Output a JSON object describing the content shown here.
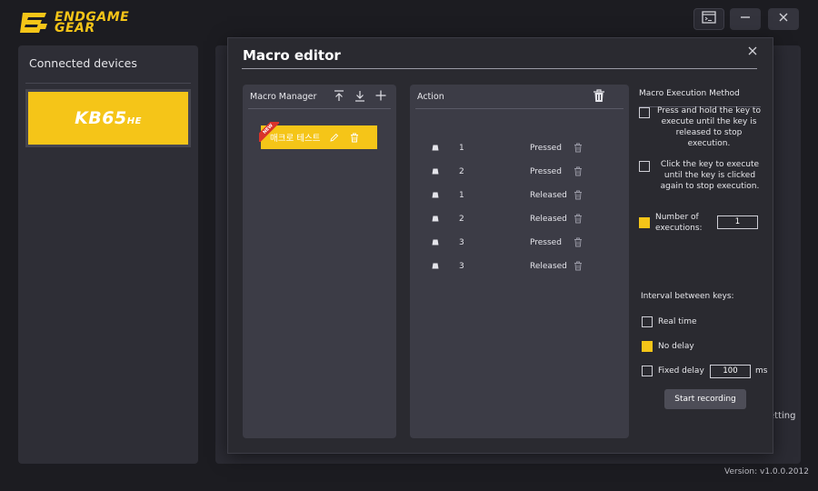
{
  "app": {
    "brand_line1": "ENDGAME",
    "brand_line2": "GEAR",
    "accent_color": "#f5c518",
    "window_buttons": [
      "terminal-icon",
      "minimize-icon",
      "close-icon"
    ]
  },
  "sidebar": {
    "title": "Connected devices",
    "device": {
      "name": "KB65",
      "suffix": "HE"
    }
  },
  "background": {
    "setting_label": "etting",
    "version": "Version: v1.0.0.2012"
  },
  "modal": {
    "title": "Macro editor",
    "close_icon": "close-icon",
    "macro_manager": {
      "title": "Macro Manager",
      "icons": [
        "upload-icon",
        "download-icon",
        "plus-icon"
      ],
      "items": [
        {
          "name": "매크로 테스트",
          "badge": "NEW"
        }
      ]
    },
    "action": {
      "title": "Action",
      "rows": [
        {
          "key": "1",
          "state": "Pressed"
        },
        {
          "key": "2",
          "state": "Pressed"
        },
        {
          "key": "1",
          "state": "Released"
        },
        {
          "key": "2",
          "state": "Released"
        },
        {
          "key": "3",
          "state": "Pressed"
        },
        {
          "key": "3",
          "state": "Released"
        }
      ]
    },
    "execution": {
      "title": "Macro Execution Method",
      "option1": "Press and hold the key to execute until the key is released to stop execution.",
      "option2": "Click the key to execute until the key is clicked again to stop execution.",
      "option3": "Number of executions:",
      "option3_value": "1",
      "selected": "option3"
    },
    "interval": {
      "title": "Interval between keys:",
      "real_time": "Real time",
      "no_delay": "No delay",
      "fixed_delay": "Fixed delay",
      "fixed_value": "100",
      "unit": "ms",
      "selected": "no_delay"
    },
    "record_button": "Start recording"
  }
}
